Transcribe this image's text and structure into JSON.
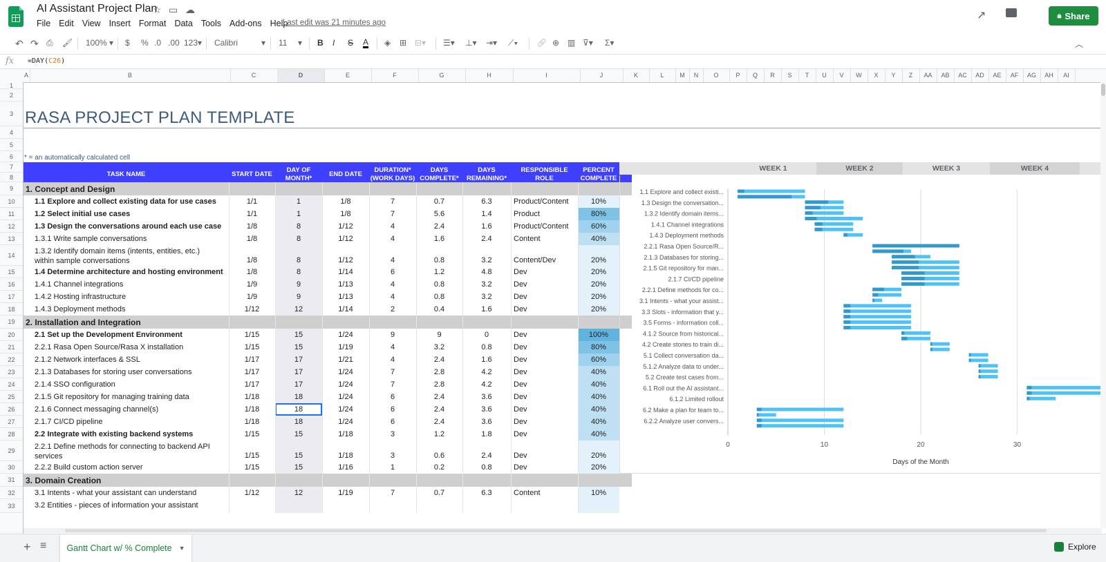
{
  "app": {
    "title": "AI Assistant Project Plan",
    "menus": [
      "File",
      "Edit",
      "View",
      "Insert",
      "Format",
      "Data",
      "Tools",
      "Add-ons",
      "Help"
    ],
    "last_edit": "Last edit was 21 minutes ago",
    "share_label": "Share"
  },
  "toolbar": {
    "zoom": "100%",
    "currency": "$",
    "percent": "%",
    "dec_less": ".0",
    "dec_more": ".00",
    "format_more": "123",
    "font": "Calibri",
    "font_size": "11"
  },
  "formula_bar": {
    "fx": "fx",
    "prefix": "=DAY(",
    "ref": "C26",
    "suffix": ")"
  },
  "columns": [
    "A",
    "B",
    "C",
    "D",
    "E",
    "F",
    "G",
    "H",
    "I",
    "J",
    "K",
    "L",
    "M",
    "N",
    "O",
    "P",
    "Q",
    "R",
    "S",
    "T",
    "U",
    "V",
    "W",
    "X",
    "Y",
    "Z",
    "AA",
    "AB",
    "AC",
    "AD",
    "AE",
    "AF",
    "AG",
    "AH",
    "AI"
  ],
  "rows": [
    "1",
    "2",
    "3",
    "4",
    "5",
    "6",
    "7",
    "8",
    "9",
    "10",
    "11",
    "12",
    "13",
    "14",
    "15",
    "16",
    "17",
    "18",
    "19",
    "20",
    "21",
    "22",
    "23",
    "24",
    "25",
    "26",
    "27",
    "28",
    "29",
    "30",
    "31",
    "32",
    "33"
  ],
  "sheet": {
    "title": "RASA PROJECT PLAN TEMPLATE",
    "footnote": "* = an automatically calculated cell",
    "headers": {
      "task": "TASK NAME",
      "start": "START DATE",
      "dom": "DAY OF MONTH*",
      "end": "END DATE",
      "duration": "DURATION* (WORK DAYS)",
      "done": "DAYS COMPLETE*",
      "remaining": "DAYS REMAINING*",
      "role": "RESPONSIBLE ROLE",
      "pct": "PERCENT COMPLETE"
    },
    "tasks": [
      {
        "type": "section",
        "task": "1. Concept and Design"
      },
      {
        "type": "task",
        "bold": true,
        "task": "1.1 Explore and collect existing data for use cases",
        "start": "1/1",
        "dom": "1",
        "end": "1/8",
        "dur": "7",
        "done": "0.7",
        "rem": "6.3",
        "role": "Product/Content",
        "pct": "10%",
        "pv": 10
      },
      {
        "type": "task",
        "bold": true,
        "task": "1.2   Select initial use cases",
        "start": "1/1",
        "dom": "1",
        "end": "1/8",
        "dur": "7",
        "done": "5.6",
        "rem": "1.4",
        "role": "Product",
        "pct": "80%",
        "pv": 80
      },
      {
        "type": "task",
        "bold": true,
        "task": "1.3   Design the conversations around each use case",
        "start": "1/8",
        "dom": "8",
        "end": "1/12",
        "dur": "4",
        "done": "2.4",
        "rem": "1.6",
        "role": "Product/Content",
        "pct": "60%",
        "pv": 60
      },
      {
        "type": "task",
        "task": "1.3.1     Write sample conversations",
        "start": "1/8",
        "dom": "8",
        "end": "1/12",
        "dur": "4",
        "done": "1.6",
        "rem": "2.4",
        "role": "Content",
        "pct": "40%",
        "pv": 40
      },
      {
        "type": "task",
        "tall": true,
        "task": "1.3.2     Identify domain items (intents, entities, etc.)",
        "task2": "within sample conversations",
        "start": "1/8",
        "dom": "8",
        "end": "1/12",
        "dur": "4",
        "done": "0.8",
        "rem": "3.2",
        "role": "Content/Dev",
        "pct": "20%",
        "pv": 20
      },
      {
        "type": "task",
        "bold": true,
        "task": "1.4 Determine architecture and hosting environment",
        "start": "1/8",
        "dom": "8",
        "end": "1/14",
        "dur": "6",
        "done": "1.2",
        "rem": "4.8",
        "role": "Dev",
        "pct": "20%",
        "pv": 20
      },
      {
        "type": "task",
        "task": "1.4.1       Channel integrations",
        "start": "1/9",
        "dom": "9",
        "end": "1/13",
        "dur": "4",
        "done": "0.8",
        "rem": "3.2",
        "role": "Dev",
        "pct": "20%",
        "pv": 20
      },
      {
        "type": "task",
        "task": "1.4.2     Hosting infrastructure",
        "start": "1/9",
        "dom": "9",
        "end": "1/13",
        "dur": "4",
        "done": "0.8",
        "rem": "3.2",
        "role": "Dev",
        "pct": "20%",
        "pv": 20
      },
      {
        "type": "task",
        "task": "1.4.3     Deployment methods",
        "start": "1/12",
        "dom": "12",
        "end": "1/14",
        "dur": "2",
        "done": "0.4",
        "rem": "1.6",
        "role": "Dev",
        "pct": "20%",
        "pv": 20
      },
      {
        "type": "section",
        "task": "2. Installation and Integration"
      },
      {
        "type": "task",
        "bold": true,
        "task": "2.1 Set up the Development Environment",
        "start": "1/15",
        "dom": "15",
        "end": "1/24",
        "dur": "9",
        "done": "9",
        "rem": "0",
        "role": "Dev",
        "pct": "100%",
        "pv": 100
      },
      {
        "type": "task",
        "task": "2.2.1     Rasa Open Source/Rasa X installation",
        "start": "1/15",
        "dom": "15",
        "end": "1/19",
        "dur": "4",
        "done": "3.2",
        "rem": "0.8",
        "role": "Dev",
        "pct": "80%",
        "pv": 80
      },
      {
        "type": "task",
        "task": "2.1.2     Network interfaces & SSL",
        "start": "1/17",
        "dom": "17",
        "end": "1/21",
        "dur": "4",
        "done": "2.4",
        "rem": "1.6",
        "role": "Dev",
        "pct": "60%",
        "pv": 60
      },
      {
        "type": "task",
        "task": "2.1.3     Databases for storing user conversations",
        "start": "1/17",
        "dom": "17",
        "end": "1/24",
        "dur": "7",
        "done": "2.8",
        "rem": "4.2",
        "role": "Dev",
        "pct": "40%",
        "pv": 40
      },
      {
        "type": "task",
        "task": "2.1.4     SSO configuration",
        "start": "1/17",
        "dom": "17",
        "end": "1/24",
        "dur": "7",
        "done": "2.8",
        "rem": "4.2",
        "role": "Dev",
        "pct": "40%",
        "pv": 40
      },
      {
        "type": "task",
        "task": "2.1.5     Git repository for managing training data",
        "start": "1/18",
        "dom": "18",
        "end": "1/24",
        "dur": "6",
        "done": "2.4",
        "rem": "3.6",
        "role": "Dev",
        "pct": "40%",
        "pv": 40
      },
      {
        "type": "task",
        "selected": true,
        "task": "2.1.6     Connect messaging channel(s)",
        "start": "1/18",
        "dom": "18",
        "end": "1/24",
        "dur": "6",
        "done": "2.4",
        "rem": "3.6",
        "role": "Dev",
        "pct": "40%",
        "pv": 40
      },
      {
        "type": "task",
        "task": "2.1.7     CI/CD pipeline",
        "start": "1/18",
        "dom": "18",
        "end": "1/24",
        "dur": "6",
        "done": "2.4",
        "rem": "3.6",
        "role": "Dev",
        "pct": "40%",
        "pv": 40
      },
      {
        "type": "task",
        "bold": true,
        "task": "2.2 Integrate with existing backend systems",
        "start": "1/15",
        "dom": "15",
        "end": "1/18",
        "dur": "3",
        "done": "1.2",
        "rem": "1.8",
        "role": "Dev",
        "pct": "40%",
        "pv": 40
      },
      {
        "type": "task",
        "tall": true,
        "task": "2.2.1     Define methods for connecting to backend API",
        "task2": "services",
        "start": "1/15",
        "dom": "15",
        "end": "1/18",
        "dur": "3",
        "done": "0.6",
        "rem": "2.4",
        "role": "Dev",
        "pct": "20%",
        "pv": 20
      },
      {
        "type": "task",
        "task": "2.2.2     Build custom action server",
        "start": "1/15",
        "dom": "15",
        "end": "1/16",
        "dur": "1",
        "done": "0.2",
        "rem": "0.8",
        "role": "Dev",
        "pct": "20%",
        "pv": 20
      },
      {
        "type": "section",
        "task": "3. Domain Creation"
      },
      {
        "type": "task",
        "task": "3.1  Intents - what your assistant can understand",
        "start": "1/12",
        "dom": "12",
        "end": "1/19",
        "dur": "7",
        "done": "0.7",
        "rem": "6.3",
        "role": "Content",
        "pct": "10%",
        "pv": 10
      },
      {
        "type": "task",
        "tall": true,
        "cut": true,
        "task": "3.2  Entities - pieces of information your assistant",
        "task2": "",
        "start": "",
        "dom": "",
        "end": "",
        "dur": "",
        "done": "",
        "rem": "",
        "role": "",
        "pct": "",
        "pv": 10
      }
    ],
    "colors": {
      "header": "#3f3fff",
      "section": "#cfcfcf",
      "title": "#3d5a80",
      "pct_low": "#e3f1fa",
      "pct_high": "#5fb3dd",
      "bar": "#4fc3f7",
      "bar_done": "#3399cc"
    }
  },
  "chart_data": {
    "type": "bar",
    "orientation": "horizontal-stacked (Gantt)",
    "weeks": [
      "WEEK 1",
      "WEEK 2",
      "WEEK 3",
      "WEEK 4"
    ],
    "categories": [
      "1.1 Explore and collect existi...",
      "1.3   Design the conversation...",
      "1.3.2    Identify domain items...",
      "1.4.1      Channel integrations",
      "1.4.3      Deployment methods",
      "2.2.1      Rasa Open Source/R...",
      "2.1.3     Databases for storing...",
      "2.1.5     Git repository for man...",
      "2.1.7      CI/CD pipeline",
      "2.2.1    Define methods for co...",
      "3.1  Intents - what your assist...",
      "3.3  Slots - information that y...",
      "3.5  Forms - information coll...",
      "4.1.2    Source from historical...",
      "4.2   Create stories to train di...",
      "5.1     Collect conversation da...",
      "5.1.2    Analyze data to under...",
      "5.2    Create test cases from...",
      "6.1   Roll out the AI assistant...",
      "6.1.2      Limited rollout",
      "6.2    Make a plan for team to...",
      "6.2.2    Analyze user convers..."
    ],
    "bars": [
      {
        "start": 1,
        "dur": 7,
        "done": 0.7,
        "row": 0
      },
      {
        "start": 1,
        "dur": 7,
        "done": 5.6,
        "row": 0.5
      },
      {
        "start": 8,
        "dur": 4,
        "done": 2.4,
        "row": 1
      },
      {
        "start": 8,
        "dur": 4,
        "done": 1.6,
        "row": 1.5
      },
      {
        "start": 8,
        "dur": 4,
        "done": 0.8,
        "row": 2
      },
      {
        "start": 8,
        "dur": 6,
        "done": 1.2,
        "row": 2.5
      },
      {
        "start": 9,
        "dur": 4,
        "done": 0.8,
        "row": 3
      },
      {
        "start": 9,
        "dur": 4,
        "done": 0.8,
        "row": 3.5
      },
      {
        "start": 12,
        "dur": 2,
        "done": 0.4,
        "row": 4
      },
      {
        "start": 15,
        "dur": 9,
        "done": 9,
        "row": 5
      },
      {
        "start": 15,
        "dur": 4,
        "done": 3.2,
        "row": 5.5
      },
      {
        "start": 17,
        "dur": 4,
        "done": 2.4,
        "row": 6
      },
      {
        "start": 17,
        "dur": 7,
        "done": 2.8,
        "row": 6.5
      },
      {
        "start": 17,
        "dur": 7,
        "done": 2.8,
        "row": 7
      },
      {
        "start": 18,
        "dur": 6,
        "done": 2.4,
        "row": 7.5
      },
      {
        "start": 18,
        "dur": 6,
        "done": 2.4,
        "row": 8
      },
      {
        "start": 18,
        "dur": 6,
        "done": 2.4,
        "row": 8.5
      },
      {
        "start": 15,
        "dur": 3,
        "done": 1.2,
        "row": 9
      },
      {
        "start": 15,
        "dur": 3,
        "done": 0.6,
        "row": 9.5
      },
      {
        "start": 15,
        "dur": 1,
        "done": 0.2,
        "row": 10
      },
      {
        "start": 12,
        "dur": 7,
        "done": 0.7,
        "row": 10.5
      },
      {
        "start": 12,
        "dur": 7,
        "done": 0.7,
        "row": 11
      },
      {
        "start": 12,
        "dur": 7,
        "done": 0.7,
        "row": 11.5
      },
      {
        "start": 12,
        "dur": 7,
        "done": 0.7,
        "row": 12
      },
      {
        "start": 12,
        "dur": 7,
        "done": 0.7,
        "row": 12.5
      },
      {
        "start": 18,
        "dur": 3,
        "done": 0.3,
        "row": 13
      },
      {
        "start": 18,
        "dur": 3,
        "done": 0.6,
        "row": 13.5
      },
      {
        "start": 21,
        "dur": 2,
        "done": 0.2,
        "row": 14
      },
      {
        "start": 21,
        "dur": 2,
        "done": 0.2,
        "row": 14.5
      },
      {
        "start": 25,
        "dur": 2,
        "done": 0.2,
        "row": 15
      },
      {
        "start": 25,
        "dur": 2,
        "done": 0.2,
        "row": 15.5
      },
      {
        "start": 26,
        "dur": 2,
        "done": 0.2,
        "row": 16
      },
      {
        "start": 26,
        "dur": 2,
        "done": 0.2,
        "row": 16.5
      },
      {
        "start": 26,
        "dur": 2,
        "done": 0.2,
        "row": 17
      },
      {
        "start": 31,
        "dur": 9,
        "done": 0.5,
        "row": 18
      },
      {
        "start": 31,
        "dur": 9,
        "done": 0.5,
        "row": 18.5
      },
      {
        "start": 31,
        "dur": 3,
        "done": 0.3,
        "row": 19
      },
      {
        "start": 3,
        "dur": 9,
        "done": 0.5,
        "row": 20
      },
      {
        "start": 3,
        "dur": 2,
        "done": 0.2,
        "row": 20.5
      },
      {
        "start": 3,
        "dur": 9,
        "done": 0.5,
        "row": 21
      },
      {
        "start": 3,
        "dur": 9,
        "done": 0.5,
        "row": 21.5
      }
    ],
    "xlim": [
      0,
      39
    ],
    "xticks": [
      0,
      10,
      20,
      30
    ],
    "xlabel": "Days of the Month",
    "gridlines": true
  },
  "bottom": {
    "sheet_tab": "Gantt Chart w/ % Complete",
    "explore": "Explore",
    "add": "+",
    "list": "≡"
  }
}
